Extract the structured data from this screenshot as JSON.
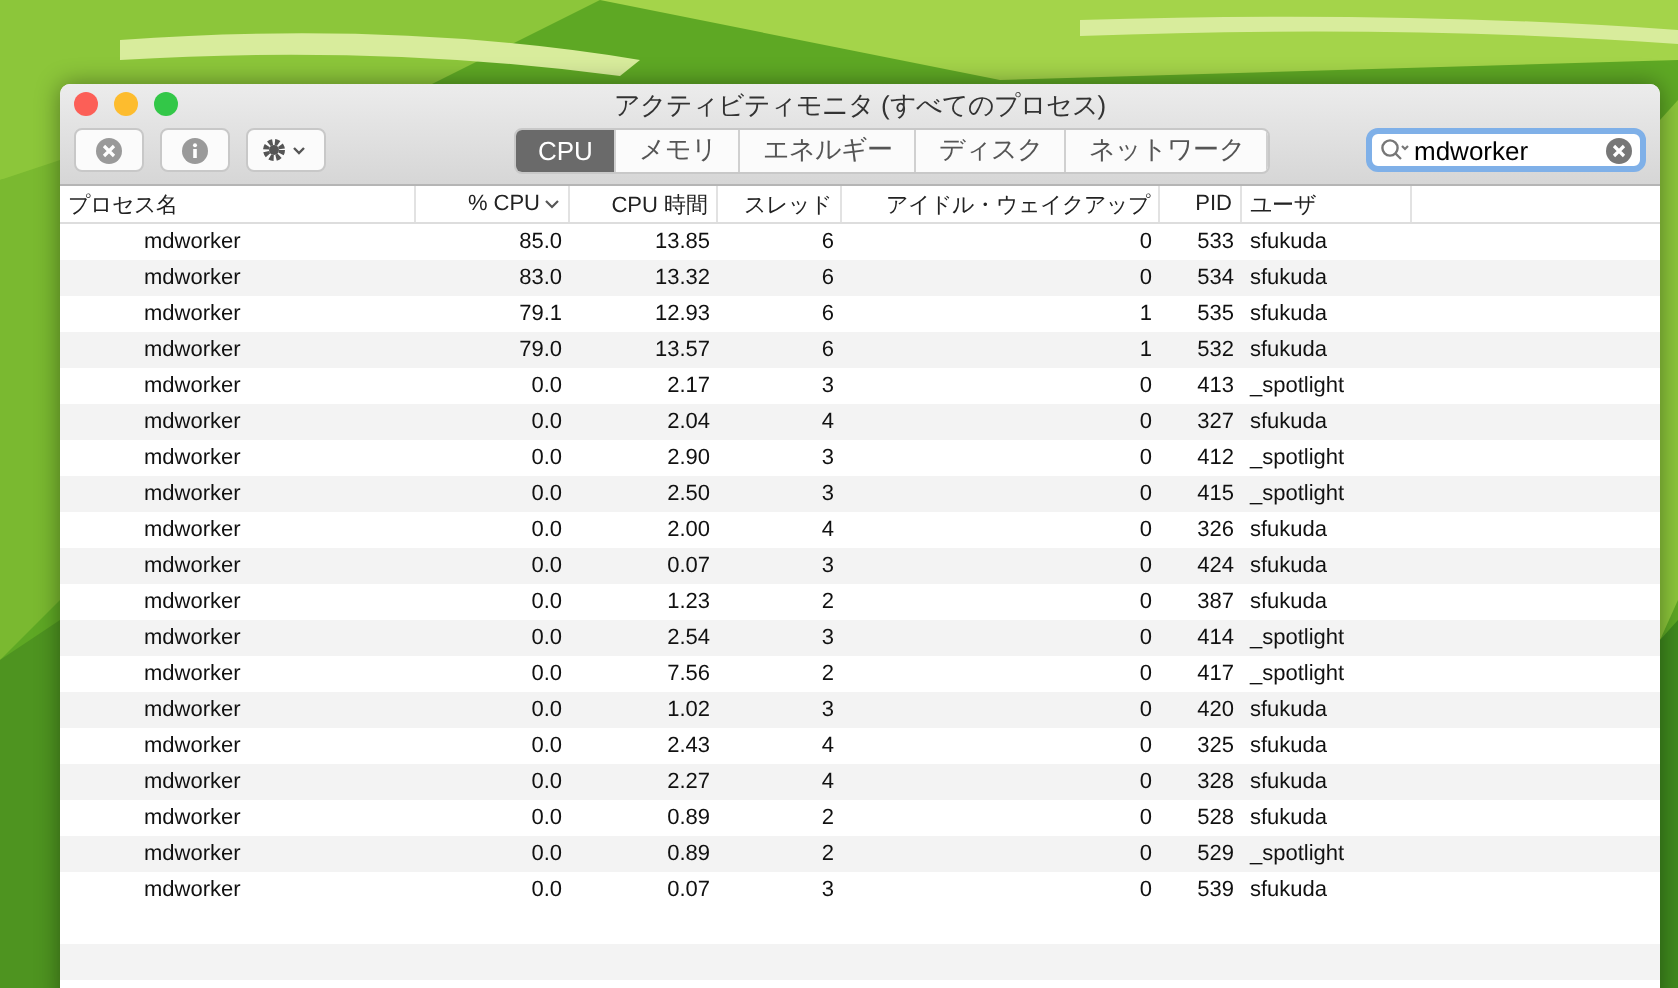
{
  "window": {
    "title": "アクティビティモニタ (すべてのプロセス)"
  },
  "tabs": [
    {
      "label": "CPU",
      "selected": true
    },
    {
      "label": "メモリ",
      "selected": false
    },
    {
      "label": "エネルギー",
      "selected": false
    },
    {
      "label": "ディスク",
      "selected": false
    },
    {
      "label": "ネットワーク",
      "selected": false
    }
  ],
  "search": {
    "value": "mdworker"
  },
  "table": {
    "columns": [
      {
        "label": "プロセス名",
        "sorted": false
      },
      {
        "label": "% CPU",
        "sorted": true
      },
      {
        "label": "CPU 時間",
        "sorted": false
      },
      {
        "label": "スレッド",
        "sorted": false
      },
      {
        "label": "アイドル・ウェイクアップ",
        "sorted": false
      },
      {
        "label": "PID",
        "sorted": false
      },
      {
        "label": "ユーザ",
        "sorted": false
      }
    ],
    "rows": [
      [
        "mdworker",
        "85.0",
        "13.85",
        "6",
        "0",
        "533",
        "sfukuda"
      ],
      [
        "mdworker",
        "83.0",
        "13.32",
        "6",
        "0",
        "534",
        "sfukuda"
      ],
      [
        "mdworker",
        "79.1",
        "12.93",
        "6",
        "1",
        "535",
        "sfukuda"
      ],
      [
        "mdworker",
        "79.0",
        "13.57",
        "6",
        "1",
        "532",
        "sfukuda"
      ],
      [
        "mdworker",
        "0.0",
        "2.17",
        "3",
        "0",
        "413",
        "_spotlight"
      ],
      [
        "mdworker",
        "0.0",
        "2.04",
        "4",
        "0",
        "327",
        "sfukuda"
      ],
      [
        "mdworker",
        "0.0",
        "2.90",
        "3",
        "0",
        "412",
        "_spotlight"
      ],
      [
        "mdworker",
        "0.0",
        "2.50",
        "3",
        "0",
        "415",
        "_spotlight"
      ],
      [
        "mdworker",
        "0.0",
        "2.00",
        "4",
        "0",
        "326",
        "sfukuda"
      ],
      [
        "mdworker",
        "0.0",
        "0.07",
        "3",
        "0",
        "424",
        "sfukuda"
      ],
      [
        "mdworker",
        "0.0",
        "1.23",
        "2",
        "0",
        "387",
        "sfukuda"
      ],
      [
        "mdworker",
        "0.0",
        "2.54",
        "3",
        "0",
        "414",
        "_spotlight"
      ],
      [
        "mdworker",
        "0.0",
        "7.56",
        "2",
        "0",
        "417",
        "_spotlight"
      ],
      [
        "mdworker",
        "0.0",
        "1.02",
        "3",
        "0",
        "420",
        "sfukuda"
      ],
      [
        "mdworker",
        "0.0",
        "2.43",
        "4",
        "0",
        "325",
        "sfukuda"
      ],
      [
        "mdworker",
        "0.0",
        "2.27",
        "4",
        "0",
        "328",
        "sfukuda"
      ],
      [
        "mdworker",
        "0.0",
        "0.89",
        "2",
        "0",
        "528",
        "sfukuda"
      ],
      [
        "mdworker",
        "0.0",
        "0.89",
        "2",
        "0",
        "529",
        "_spotlight"
      ],
      [
        "mdworker",
        "0.0",
        "0.07",
        "3",
        "0",
        "539",
        "sfukuda"
      ]
    ]
  }
}
